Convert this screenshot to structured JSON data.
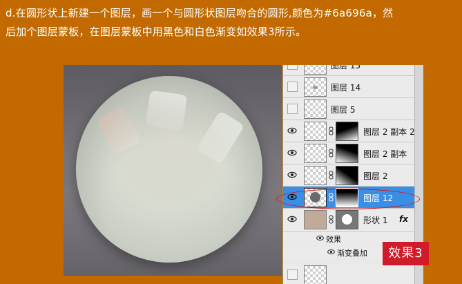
{
  "instruction": {
    "line1": "d.在圆形状上新建一个图层，画一个与圆形状图层吻合的圆形,颜色为#6a696a，然",
    "line2": "后加个图层蒙板，在图层蒙板中用黑色和白色渐变如效果3所示。"
  },
  "layers": [
    {
      "name": "图层 15"
    },
    {
      "name": "图层 14"
    },
    {
      "name": "图层 5"
    },
    {
      "name": "图层 2 副本 2"
    },
    {
      "name": "图层 2 副本"
    },
    {
      "name": "图层 2"
    },
    {
      "name": "图层 12"
    },
    {
      "name": "形状 1"
    }
  ],
  "effects": {
    "label": "效果",
    "gradient_overlay": "渐变叠加",
    "fx": "fx"
  },
  "badge": {
    "label": "效果3"
  },
  "colors": {
    "background": "#c26a00",
    "selected": "#3a8ee6",
    "annotation": "#d21c1c",
    "badge": "#d11a2a"
  }
}
